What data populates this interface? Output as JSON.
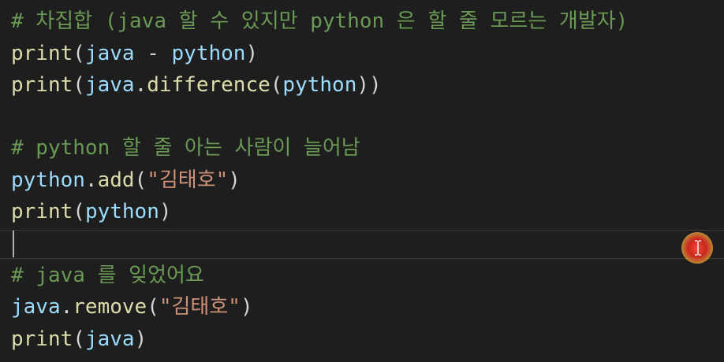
{
  "editor": {
    "lines": [
      {
        "segments": [
          {
            "cls": "cm",
            "text": "# 차집합 (java 할 수 있지만 python 은 할 줄 모르는 개발자)"
          }
        ]
      },
      {
        "segments": [
          {
            "cls": "fn",
            "text": "print"
          },
          {
            "cls": "pun",
            "text": "("
          },
          {
            "cls": "var",
            "text": "java"
          },
          {
            "cls": "pun",
            "text": " - "
          },
          {
            "cls": "var",
            "text": "python"
          },
          {
            "cls": "pun",
            "text": ")"
          }
        ]
      },
      {
        "segments": [
          {
            "cls": "fn",
            "text": "print"
          },
          {
            "cls": "pun",
            "text": "("
          },
          {
            "cls": "var",
            "text": "java"
          },
          {
            "cls": "pun",
            "text": "."
          },
          {
            "cls": "fn",
            "text": "difference"
          },
          {
            "cls": "pun",
            "text": "("
          },
          {
            "cls": "var",
            "text": "python"
          },
          {
            "cls": "pun",
            "text": "))"
          }
        ]
      },
      {
        "segments": []
      },
      {
        "segments": [
          {
            "cls": "cm",
            "text": "# python 할 줄 아는 사람이 늘어남"
          }
        ]
      },
      {
        "segments": [
          {
            "cls": "var",
            "text": "python"
          },
          {
            "cls": "pun",
            "text": "."
          },
          {
            "cls": "fn",
            "text": "add"
          },
          {
            "cls": "pun",
            "text": "("
          },
          {
            "cls": "str",
            "text": "\"김태호\""
          },
          {
            "cls": "pun",
            "text": ")"
          }
        ]
      },
      {
        "segments": [
          {
            "cls": "fn",
            "text": "print"
          },
          {
            "cls": "pun",
            "text": "("
          },
          {
            "cls": "var",
            "text": "python"
          },
          {
            "cls": "pun",
            "text": ")"
          }
        ]
      },
      {
        "segments": []
      },
      {
        "segments": [
          {
            "cls": "cm",
            "text": "# java 를 잊었어요"
          }
        ]
      },
      {
        "segments": [
          {
            "cls": "var",
            "text": "java"
          },
          {
            "cls": "pun",
            "text": "."
          },
          {
            "cls": "fn",
            "text": "remove"
          },
          {
            "cls": "pun",
            "text": "("
          },
          {
            "cls": "str",
            "text": "\"김태호\""
          },
          {
            "cls": "pun",
            "text": ")"
          }
        ]
      },
      {
        "segments": [
          {
            "cls": "fn",
            "text": "print"
          },
          {
            "cls": "pun",
            "text": "("
          },
          {
            "cls": "var",
            "text": "java"
          },
          {
            "cls": "pun",
            "text": ")"
          }
        ]
      }
    ]
  },
  "theme": {
    "background": "#1e1e1e",
    "comment": "#6a9955",
    "function": "#dcdcaa",
    "string": "#ce9178",
    "variable": "#9cdcfe",
    "punctuation": "#d4d4d4"
  },
  "cursor": {
    "icon": "i-beam-cursor-icon",
    "active_line_index": 7
  }
}
